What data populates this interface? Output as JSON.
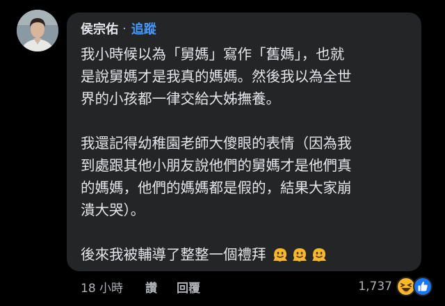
{
  "comment": {
    "author": "侯宗佑",
    "separator": "·",
    "follow_label": "追蹤",
    "paragraphs": [
      [
        "我小時候以為「舅媽」寫作「舊媽」，也就",
        "是說舅媽才是我真的媽媽。然後我以為全世",
        "界的小孩都一律交給大姊撫養。"
      ],
      [
        "我還記得幼稚園老師大傻眼的表情（因為我",
        "到處跟其他小朋友說他們的舅媽才是他們真",
        "的媽媽，他們的媽媽都是假的，結果大家崩",
        "潰大哭）。"
      ],
      [
        "後來我被輔導了整整一個禮拜"
      ]
    ],
    "trailing_emojis": [
      "melting-face-icon",
      "melting-face-icon",
      "melting-face-icon"
    ],
    "timestamp": "18 小時",
    "like_label": "讚",
    "reply_label": "回覆",
    "reaction_count": "1,737",
    "reaction_icons": [
      "haha-reaction-icon",
      "like-reaction-icon"
    ]
  },
  "colors": {
    "background": "#000000",
    "bubble": "#242526",
    "text": "#e4e6eb",
    "secondary_text": "#b0b3b8",
    "link": "#4599ff",
    "like_blue": "#1877f2",
    "haha_yellow": "#f7b928"
  }
}
